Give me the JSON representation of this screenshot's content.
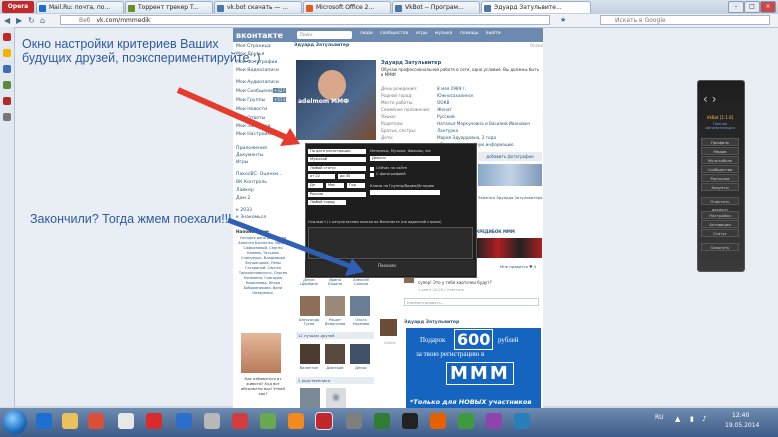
{
  "browser": {
    "menu_label": "Opera",
    "tabs": [
      {
        "label": "Mail.Ru: почта, по...",
        "active": false
      },
      {
        "label": "Торрент трекер T...",
        "active": false
      },
      {
        "label": "vk.bot скачать — ...",
        "active": false
      },
      {
        "label": "Microsoft Office 2...",
        "active": false
      },
      {
        "label": "VkBot -- Програм...",
        "active": false
      },
      {
        "label": "Эдуард Затульвите...",
        "active": true
      }
    ],
    "address_prefix": "Веб",
    "address_url": "vk.com/mmmedik",
    "search_placeholder": "Искать в Google"
  },
  "vk": {
    "logo": "вконтакте",
    "search_placeholder": "Поиск",
    "nav": "люди сообщества игры музыка помощь выйти",
    "user_header": "Эдуард Затульвитер",
    "left_menu": [
      {
        "label": "Моя Страница"
      },
      {
        "label": "Мои Друзья"
      },
      {
        "label": "Мои Фотографии"
      },
      {
        "label": "Мои Видеозаписи"
      },
      {
        "label": "Мои Аудиозаписи"
      },
      {
        "label": "Мои Сообщения",
        "badge": "+327"
      },
      {
        "label": "Мои Группы",
        "badge": "+573"
      },
      {
        "label": "Мои Новости"
      },
      {
        "label": "Мои Ответы"
      },
      {
        "label": "Мои Закладки"
      },
      {
        "label": "Мои Настройки"
      },
      {
        "label": "Приложения"
      },
      {
        "label": "Документы"
      },
      {
        "label": "Игры"
      }
    ],
    "left_menu2": [
      "ПакосВС: Оценки...",
      "ВК Контроль",
      "Лайкер",
      "Дом 2"
    ],
    "left_menu3": [
      "к 2033",
      "к Знакомься"
    ],
    "birthday_title": "Напоминание",
    "birthday_text": "Сегодня день рождения Алексея Банченко, Ирины Сафроновой, Сергея Конева, Татьяны Слипченко, Владимира Заущанцева, Лены Гагариной, Сергея Тараканновского, Сергея Казанина, Григория Кириллова, Игоря Бобровникова, Вани Назаренко.",
    "ad_caption": "Как избавиться от живота? Худ вот абсолютно все! Узнай как?",
    "profile": {
      "name": "Эдуард Затульвитер",
      "status": "Обучаю профессиональной работе в сети, одно условие: Вы должны быть в ММФ!",
      "last_seen": "Online",
      "avatar_caption": "adelmom ММФ",
      "fields": [
        {
          "label": "День рождения:",
          "value": "8 мая 1989 г."
        },
        {
          "label": "Родной город:",
          "value": "Южносахалинск"
        },
        {
          "label": "Место работы:",
          "value": "ООКВ"
        },
        {
          "label": "Семейное положение:",
          "value": "Женат"
        },
        {
          "label": "Языки:",
          "value": "Русский"
        },
        {
          "label": "Родители:",
          "value": "Наталья Маркуновна и Василий Иванович"
        },
        {
          "label": "Братья, сестры:",
          "value": "Лантурка"
        },
        {
          "label": "Дети:",
          "value": "Мария Эдуардовна, 2 года"
        }
      ],
      "show_info": "Показать подробную информацию",
      "add_photo": "добавить фотографии",
      "notes": "Заметки Эдуарда Затульвитера",
      "music_title": "КРЕДИБОК МММ",
      "wall_author": "Эдуард Затульвитер",
      "wall_post": "Дмитрий Евдокимов",
      "wall_text": "супер! Это у тебя карточки будут?",
      "wall_meta": "1 янв в 20:26 | Ответить",
      "comment_placeholder": "Комментировать...",
      "like_text": "Мне нравится ♥ 4",
      "best_friends_title": "12 лучших друзей",
      "relatives_title": "2 родственника",
      "friends": [
        {
          "name": "Денис Щербина"
        },
        {
          "name": "Ирина Юшина"
        },
        {
          "name": "Алексей Сопнов"
        },
        {
          "name": "Александр Гусев"
        },
        {
          "name": "Рашит Исмагилов"
        },
        {
          "name": "Ольга Наумова"
        },
        {
          "name": "Валентин"
        },
        {
          "name": "Дмитрий"
        },
        {
          "name": "Денис"
        }
      ]
    }
  },
  "dialog": {
    "sort_label": "По дате регистрации",
    "gender_label": "Мужской",
    "status_label": "Любой статус",
    "age_from": "от 22",
    "age_to": "до 35",
    "day_label": "Дн",
    "month_label": "Мес",
    "year_label": "Год",
    "country_label": "Россия",
    "city_label": "Любой город",
    "interests_label": "Интересы, Музыка, Фильмы, etc",
    "interests_value": "Деньги",
    "online_now": "Сейчас на сайте",
    "with_photo": "С фотографией",
    "job_label": "Ключи на Группы/Видео/Историю",
    "results_text": "Ссылки(+) с результатами поиска во Вконтакте (на адресной строке)",
    "button_label": "Поехали"
  },
  "annotations": {
    "top_note": "Окно настройки критериев Ваших будущих друзей, поэкспериментируйте :)",
    "bottom_note": "Закончили? Тогда жмем поехали!!!"
  },
  "widget": {
    "title": "VkBot [1.1.8]",
    "subtitle": "Полная Автоматизация",
    "buttons": [
      "Профиль",
      "Медиа",
      "Мультиболк",
      "Сообщества",
      "Рассылки",
      "Акаунты",
      "Очистить аккаунт",
      "Настройки",
      "Активация",
      "Статус",
      "Свернуть"
    ]
  },
  "ad": {
    "line1": "Подарок",
    "amount": "600",
    "currency": "рублей",
    "line2": "за твою регистрацию в",
    "brand": "МММ",
    "footer": "*Только для НОВЫХ участников"
  },
  "taskbar": {
    "lang": "RU",
    "time": "12:40",
    "date": "19.05.2014"
  },
  "colors": {
    "vk_blue": "#6c8ab0",
    "link": "#2b587a",
    "note_text": "#2f5a9e",
    "arrow": "#e53b2c",
    "arrow_blue": "#2f5fb5"
  }
}
